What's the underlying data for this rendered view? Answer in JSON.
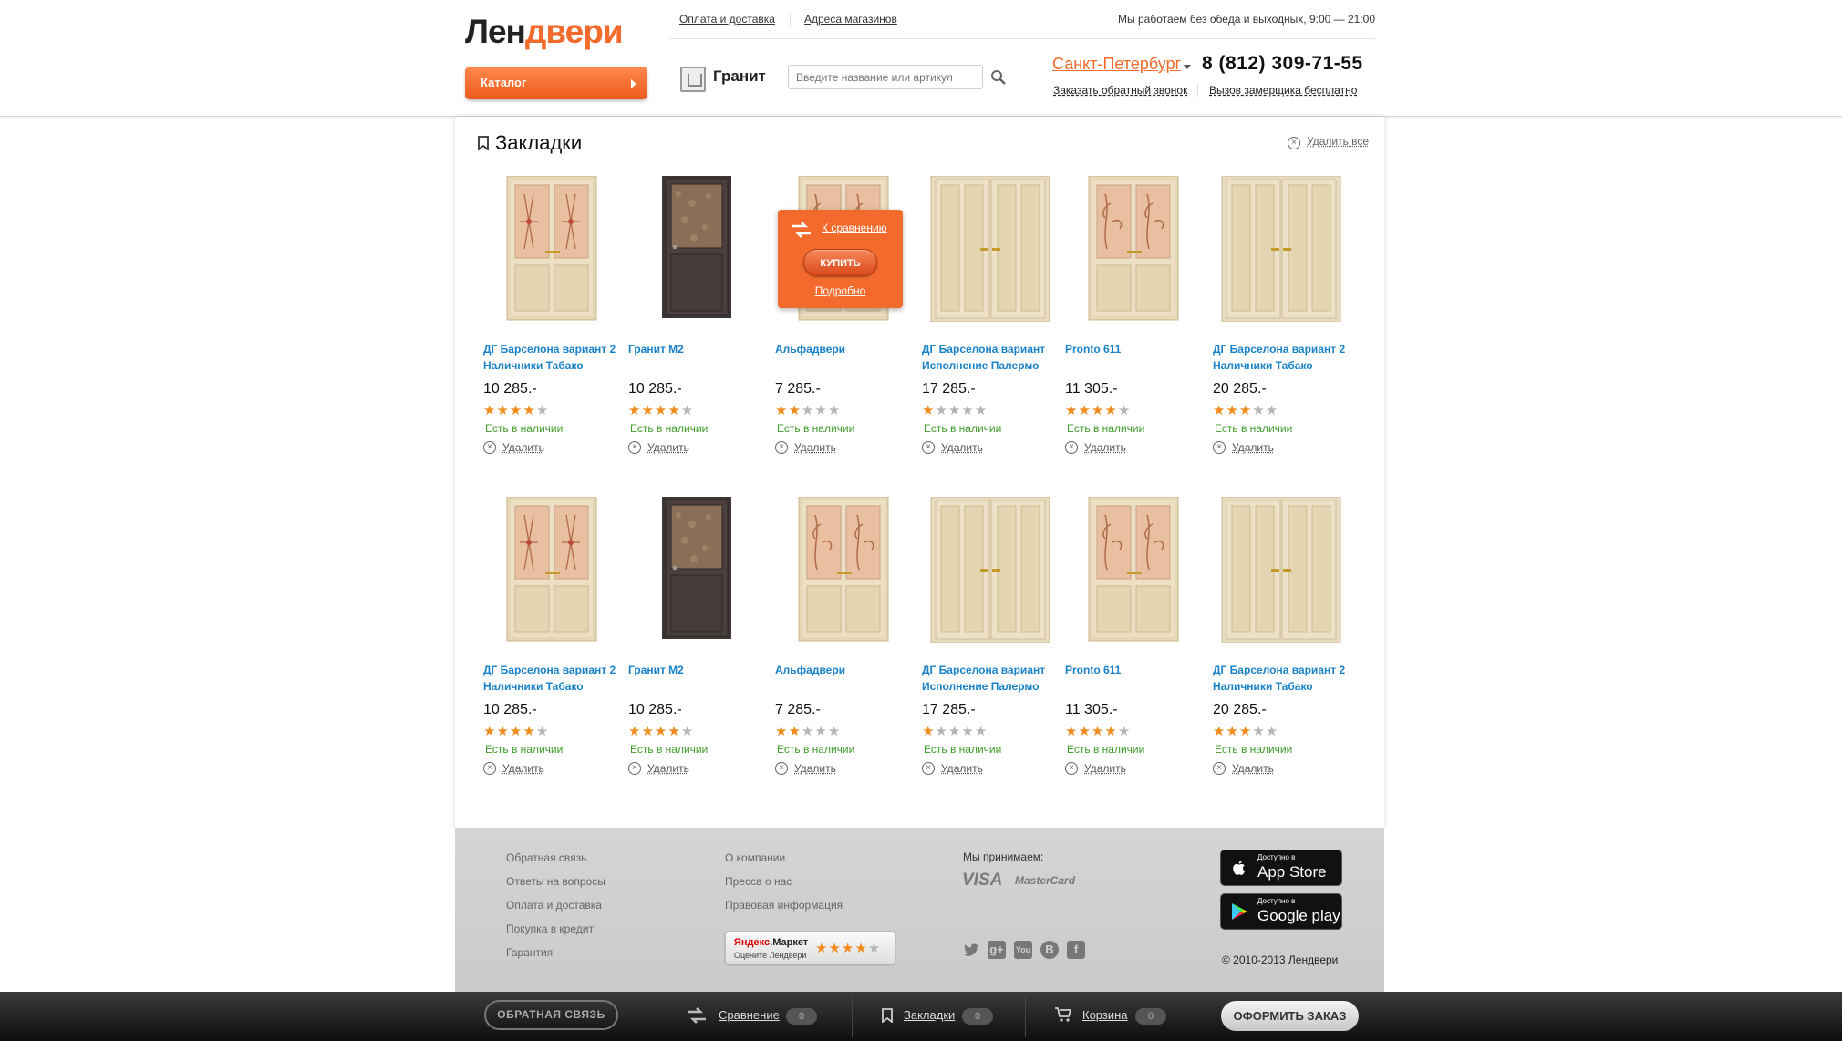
{
  "header": {
    "logo_part1": "Лен",
    "logo_part2": "двери",
    "catalog_label": "Каталог",
    "links": [
      "Оплата и доставка",
      "Адреса магазинов"
    ],
    "hours": "Мы работаем без обеда и выходных, 9:00 — 21:00",
    "brand": "Гранит",
    "search_placeholder": "Введите название или артикул",
    "city": "Санкт-Петербург",
    "phone": "8 (812) 309-71-55",
    "callback": "Заказать обратный звонок",
    "measurer": "Вызов замерщика бесплатно"
  },
  "main": {
    "title": "Закладки",
    "delete_all": "Удалить все",
    "stock_label": "Есть в наличии",
    "delete_label": "Удалить",
    "hover_card": {
      "compare": "К сравнению",
      "buy": "КУПИТЬ",
      "more": "Подробно"
    },
    "products": [
      {
        "name": "ДГ Барселона вариант 2 Наличники Табако",
        "price": "10 285.-",
        "rating": 4,
        "door": "light-glass"
      },
      {
        "name": "Гранит М2",
        "price": "10 285.-",
        "rating": 4,
        "door": "dark"
      },
      {
        "name": "Альфадвери",
        "price": "7 285.-",
        "rating": 2,
        "door": "light-floral"
      },
      {
        "name": "ДГ Барселона вариант Исполнение Палермо",
        "price": "17 285.-",
        "rating": 1,
        "door": "double"
      },
      {
        "name": "Pronto 611",
        "price": "11 305.-",
        "rating": 4,
        "door": "light-floral"
      },
      {
        "name": "ДГ Барселона вариант 2 Наличники Табако",
        "price": "20 285.-",
        "rating": 3,
        "door": "double"
      },
      {
        "name": "ДГ Барселона вариант 2 Наличники Табако",
        "price": "10 285.-",
        "rating": 4,
        "door": "light-glass"
      },
      {
        "name": "Гранит М2",
        "price": "10 285.-",
        "rating": 4,
        "door": "dark"
      },
      {
        "name": "Альфадвери",
        "price": "7 285.-",
        "rating": 2,
        "door": "light-floral"
      },
      {
        "name": "ДГ Барселона вариант Исполнение Палермо",
        "price": "17 285.-",
        "rating": 1,
        "door": "double"
      },
      {
        "name": "Pronto 611",
        "price": "11 305.-",
        "rating": 4,
        "door": "light-floral"
      },
      {
        "name": "ДГ Барселона вариант 2 Наличники Табако",
        "price": "20 285.-",
        "rating": 3,
        "door": "double"
      }
    ]
  },
  "footer": {
    "col1": [
      "Обратная связь",
      "Ответы на вопросы",
      "Оплата и доставка",
      "Покупка в кредит",
      "Гарантия"
    ],
    "col2": [
      "О компании",
      "Пресса о нас",
      "Правовая информация"
    ],
    "we_accept": "Мы принимаем:",
    "visa": "VISA",
    "mastercard": "MasterCard",
    "yandex_1a": "Яндекс",
    "yandex_1b": ".Маркет",
    "yandex_2": "Оцените Ленд­вери",
    "yandex_rating": 4,
    "social_icons": [
      "twitter-icon",
      "google-plus-icon",
      "youtube-icon",
      "vkontakte-icon",
      "facebook-icon"
    ],
    "appstore_small": "Доступно в",
    "appstore_big": "App Store",
    "gplay_small": "Доступно в",
    "gplay_big": "Google play",
    "copyright": "© 2010-2013 Лендвери"
  },
  "bottom_bar": {
    "feedback": "ОБРАТНАЯ СВЯЗЬ",
    "compare": "Сравнение",
    "compare_count": "0",
    "bookmarks": "Закладки",
    "bookmarks_count": "0",
    "cart": "Корзина",
    "cart_count": "0",
    "order": "ОФОРМИТЬ ЗАКАЗ"
  },
  "colors": {
    "accent": "#f26a2c",
    "link": "#1a82c8",
    "stock": "#3f9b2a",
    "star": "#f08c1e"
  }
}
